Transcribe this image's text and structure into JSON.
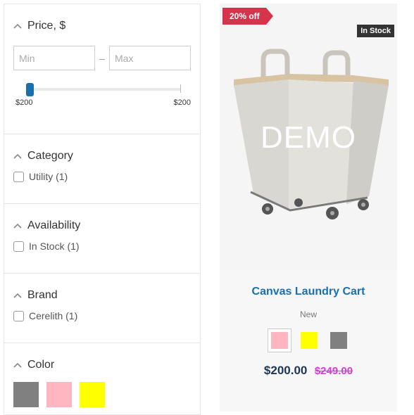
{
  "filters": {
    "price": {
      "title": "Price, $",
      "min_placeholder": "Min",
      "max_placeholder": "Max",
      "separator": "–",
      "range_min_label": "$200",
      "range_max_label": "$200"
    },
    "category": {
      "title": "Category",
      "options": [
        {
          "label": "Utility (1)"
        }
      ]
    },
    "availability": {
      "title": "Availability",
      "options": [
        {
          "label": "In Stock (1)"
        }
      ]
    },
    "brand": {
      "title": "Brand",
      "options": [
        {
          "label": "Cerelith (1)"
        }
      ]
    },
    "color": {
      "title": "Color",
      "swatches": [
        "#808080",
        "#ffb6c1",
        "#ffff00"
      ]
    }
  },
  "product": {
    "discount_badge": "20% off",
    "stock_badge": "In Stock",
    "watermark": "DEMO",
    "name": "Canvas Laundry Cart",
    "condition": "New",
    "swatches": [
      "#ffb6c1",
      "#ffff00",
      "#808080"
    ],
    "price": "$200.00",
    "old_price": "$249.00"
  },
  "colors": {
    "accent": "#1a6fad",
    "badge": "#d6334c",
    "old_price": "#d63ad9"
  }
}
